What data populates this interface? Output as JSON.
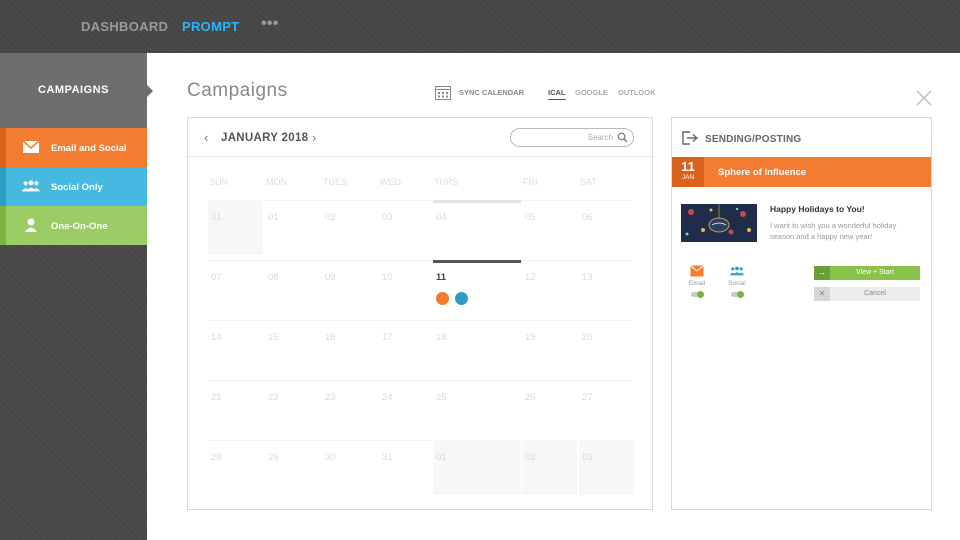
{
  "topnav": {
    "dashboard": "DASHBOARD",
    "prompt": "PROMPT",
    "more": "•••"
  },
  "sidebar": {
    "heading": "CAMPAIGNS",
    "items": [
      {
        "label": "Email and Social",
        "icon": "envelope-icon",
        "color": "#f47c30"
      },
      {
        "label": "Social Only",
        "icon": "people-icon",
        "color": "#45b9e0"
      },
      {
        "label": "One-On-One",
        "icon": "person-icon",
        "color": "#9ccc65"
      }
    ]
  },
  "header": {
    "title": "Campaigns",
    "sync_label": "SYNC CALENDAR",
    "tabs": [
      "ICAL",
      "GOOGLE",
      "OUTLOOK"
    ],
    "active_tab": "ICAL"
  },
  "calendar": {
    "month": "JANUARY 2018",
    "search_placeholder": "Search",
    "weekdays": [
      "SUN",
      "MON",
      "TUES",
      "WED",
      "THRS",
      "FRI",
      "SAT"
    ],
    "weeks": [
      [
        "31",
        "01",
        "02",
        "03",
        "04",
        "05",
        "06"
      ],
      [
        "07",
        "08",
        "09",
        "10",
        "11",
        "12",
        "13"
      ],
      [
        "14",
        "15",
        "16",
        "17",
        "18",
        "19",
        "20"
      ],
      [
        "21",
        "22",
        "23",
        "24",
        "25",
        "26",
        "27"
      ],
      [
        "28",
        "29",
        "30",
        "31",
        "01",
        "02",
        "03"
      ]
    ],
    "today": "11",
    "event_icons": [
      "email-event-icon",
      "social-event-icon"
    ]
  },
  "panel": {
    "title": "SENDING/POSTING",
    "date_day": "11",
    "date_month": "JAN",
    "campaign": "Sphere of Influence",
    "message_title": "Happy Holidays to You!",
    "message_body": "I want to wish you a wonderful holiday season and a happy new year!",
    "channels": [
      {
        "label": "Email",
        "icon": "envelope-icon",
        "enabled": true
      },
      {
        "label": "Social",
        "icon": "people-icon",
        "enabled": true
      }
    ],
    "view_button": "View + Start",
    "cancel_button": "Cancel"
  }
}
